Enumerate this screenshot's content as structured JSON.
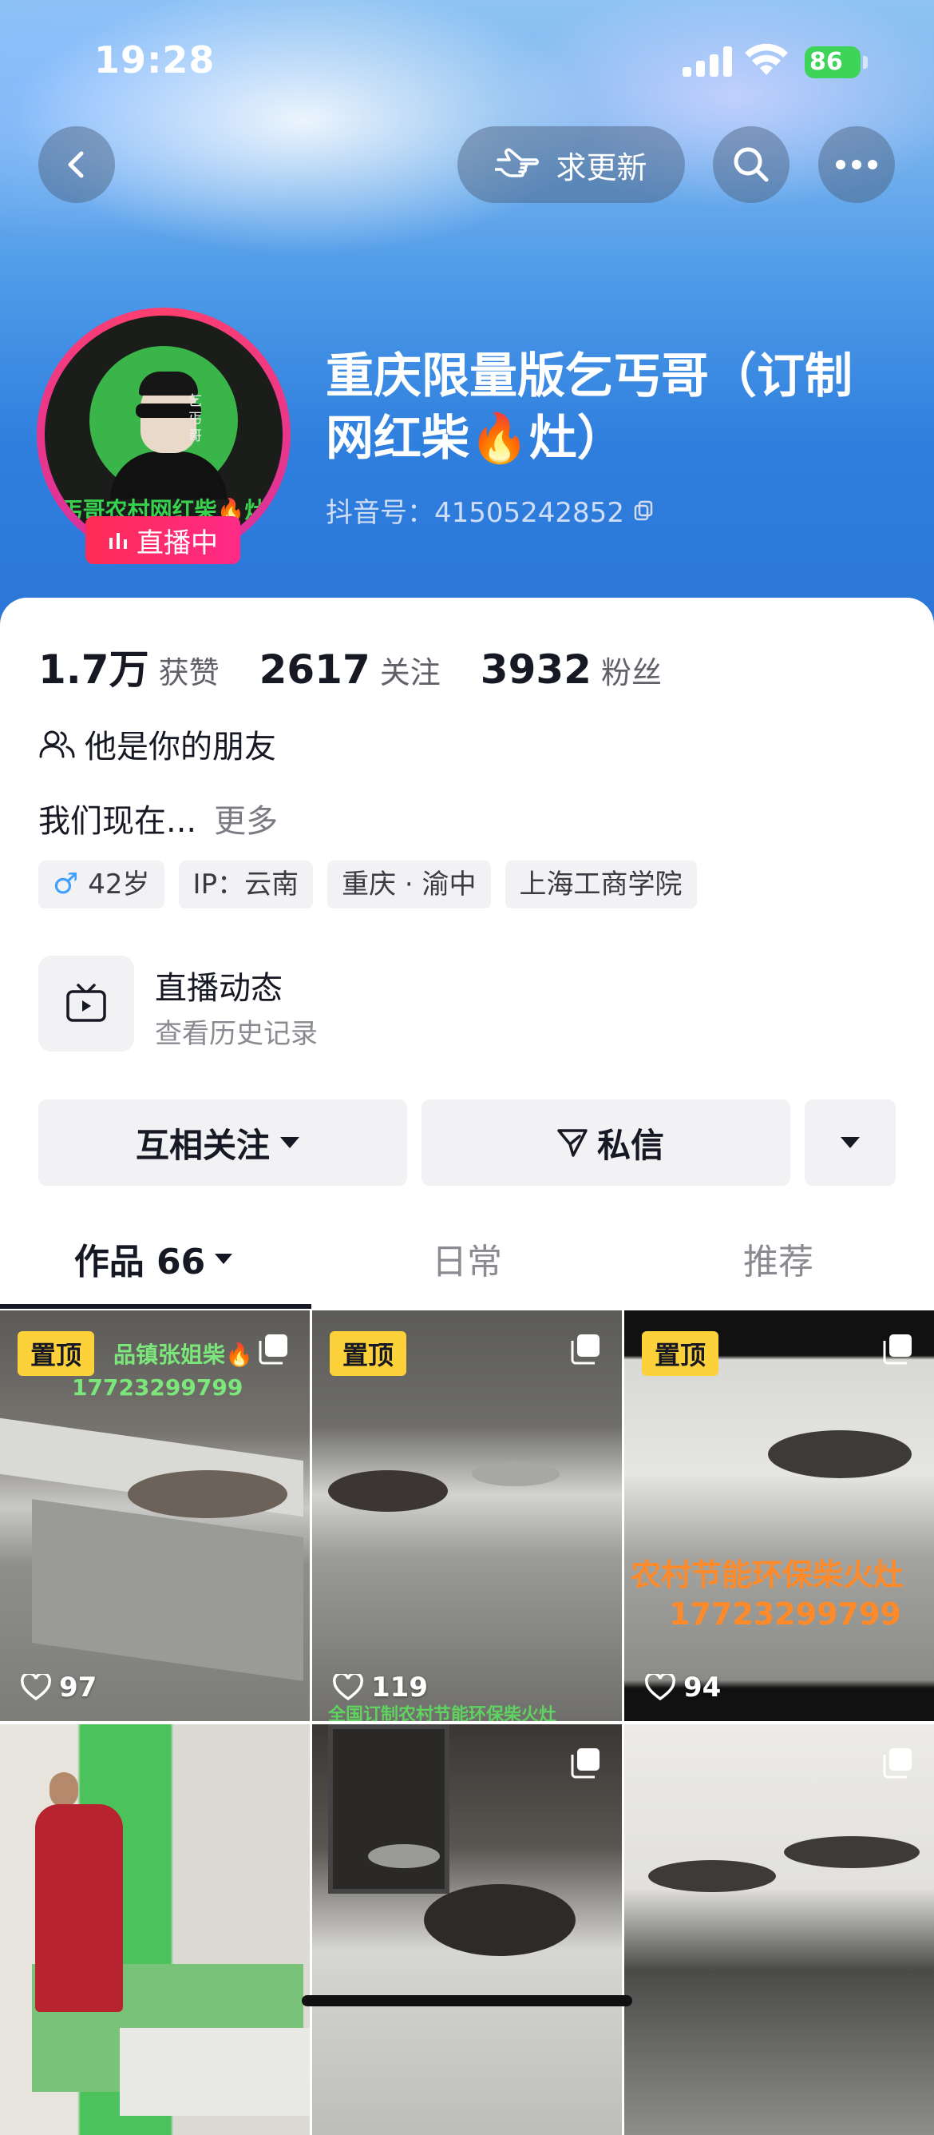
{
  "status_bar": {
    "time": "19:28",
    "battery": "86"
  },
  "header": {
    "update_label": "求更新",
    "name": "重庆限量版乞丐哥（订制网红柴🔥灶）",
    "douyin_id": "抖音号：41505242852",
    "live_badge": "直播中",
    "avatar_caption": "丐哥农村网红柴🔥灶",
    "avatar_side_text": "乞丐哥"
  },
  "stats": [
    {
      "value": "1.7万",
      "label": "获赞"
    },
    {
      "value": "2617",
      "label": "关注"
    },
    {
      "value": "3932",
      "label": "粉丝"
    }
  ],
  "friend_text": "他是你的朋友",
  "bio": {
    "text": "我们现在...",
    "more": "更多"
  },
  "tags": [
    "42岁",
    "IP：云南",
    "重庆 · 渝中",
    "上海工商学院"
  ],
  "live_history": {
    "title": "直播动态",
    "subtitle": "查看历史记录"
  },
  "actions": {
    "follow": "互相关注",
    "message": "私信"
  },
  "tabs": [
    {
      "label": "作品 66",
      "active": true
    },
    {
      "label": "日常",
      "active": false
    },
    {
      "label": "推荐",
      "active": false
    }
  ],
  "videos": [
    {
      "pinned": "置顶",
      "likes": "97",
      "overlay": "品镇张姐柴🔥",
      "overlay2": "17723299799"
    },
    {
      "pinned": "置顶",
      "likes": "119",
      "overlay": "全国订制农村节能环保柴火灶"
    },
    {
      "pinned": "置顶",
      "likes": "94",
      "overlay": "农村节能环保柴火灶",
      "overlay2": "17723299799"
    },
    {},
    {},
    {}
  ]
}
